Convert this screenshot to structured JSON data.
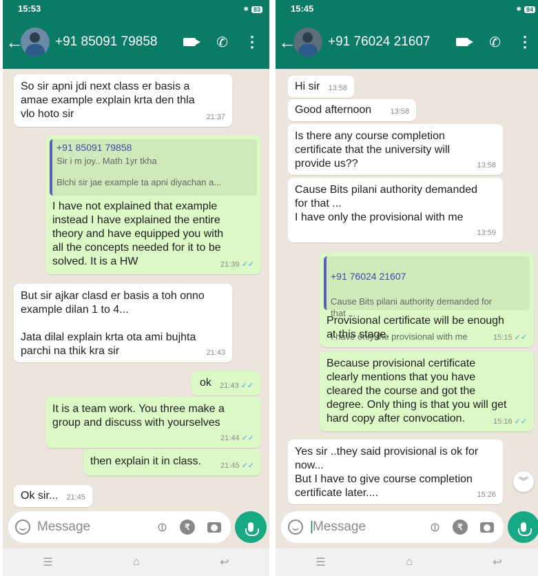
{
  "left": {
    "status_time": "15:53",
    "battery": "83",
    "contact": "+91 85091 79858",
    "messages": [
      {
        "text": "So sir apni jdi next class er basis a\namae example explain krta den thla\nvlo hoto sir",
        "time": "21:37"
      },
      {
        "quote_name": "+91 85091 79858",
        "quote_line1": "Sir i m joy.. Math 1yr tkha",
        "quote_line2": "Blchi sir jae example ta apni diyachan a...",
        "text": "I have not explained that example\ninstead I have explained the entire\ntheory and have equipped you with\nall the concepts needed for it to be\nsolved. It is a HW",
        "time": "21:39"
      },
      {
        "text": "But sir ajkar clasd er basis a toh onno\nexample dilan 1 to 4...\n\nJata dilal explain krta ota ami bujhta\nparchi na thik kra sir",
        "time": "21:43"
      },
      {
        "text": "ok",
        "time": "21:43"
      },
      {
        "text": "It is a team work. You three make a\ngroup and discuss with yourselves",
        "time": "21:44"
      },
      {
        "text": "then explain it in class.",
        "time": "21:45"
      },
      {
        "text": "Ok sir...",
        "time": "21:45"
      }
    ],
    "placeholder": "Message"
  },
  "right": {
    "status_time": "15:45",
    "battery": "84",
    "contact": "+91 76024 21607",
    "messages": [
      {
        "text": "Hi sir",
        "time": "13:58"
      },
      {
        "text": "Good afternoon",
        "time": "13:58"
      },
      {
        "text": "Is there any course completion\ncertificate that the university will\nprovide us??",
        "time": "13:58"
      },
      {
        "text": "Cause Bits pilani authority demanded\nfor that ...\nI have only the provisional with me",
        "time": "13:59"
      },
      {
        "quote_name": "+91 76024 21607",
        "quote_line1": "Cause Bits pilani authority demanded for\nthat ...",
        "quote_line2": "I have only the provisional with me",
        "text": "Provisional certificate will be enough\nat this stage.",
        "time": "15:15"
      },
      {
        "text": "Because provisional certificate\nclearly mentions that you have\ncleared the course and got the\ndegree. Only thing is that you will get\nhard copy after convocation.",
        "time": "15:16"
      },
      {
        "text": "Yes sir ..they said provisional is ok for\nnow...\nBut I have to give course completion\ncertificate later....",
        "time": "15:26"
      }
    ],
    "placeholder": "Message"
  },
  "colors": {
    "header": "#0b7b65",
    "outgoing": "#dcf8c6",
    "incoming": "#ffffff",
    "mic": "#17a884"
  },
  "icons": {
    "back": "arrow-left-icon",
    "video": "video-icon",
    "call": "phone-icon",
    "menu": "more-vert-icon",
    "emoji": "emoji-icon",
    "attach": "paperclip-icon",
    "pay": "rupee-icon",
    "camera": "camera-icon",
    "mic": "mic-icon"
  }
}
